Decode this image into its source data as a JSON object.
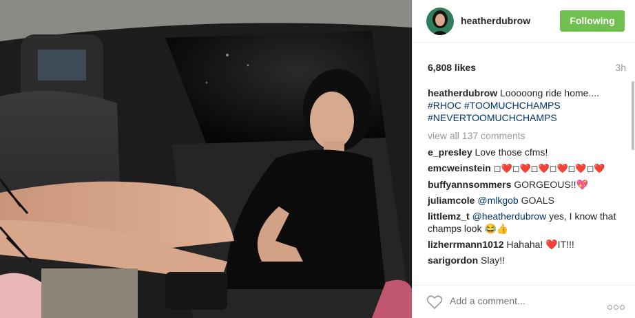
{
  "post": {
    "username": "heatherdubrow",
    "follow_label": "Following",
    "likes": "6,808 likes",
    "time": "3h",
    "caption": {
      "user": "heatherdubrow",
      "text": "Looooong ride home....",
      "tags": "#RHOC #TOOMUCHCHAMPS #NEVERTOOMUCHCHAMPS"
    },
    "view_all": "view all 137 comments",
    "comments": [
      {
        "user": "e_presley",
        "text": "Love those cfms!"
      },
      {
        "user": "emcweinstein",
        "text": "◻❤️◻❤️◻❤️◻❤️◻❤️◻❤️"
      },
      {
        "user": "buffyannsommers",
        "text": "GORGEOUS!!💖"
      },
      {
        "user": "juliamcole",
        "mention": "@mlkgob",
        "text": "GOALS"
      },
      {
        "user": "littlemz_t",
        "mention": "@heatherdubrow",
        "text": "yes, I know that champs look 😂👍"
      },
      {
        "user": "lizherrmann1012",
        "text": "Hahaha! ❤️IT!!!"
      },
      {
        "user": "sarigordon",
        "text": "Slay!!"
      }
    ],
    "add_comment_placeholder": "Add a comment...",
    "colors": {
      "follow_button": "#70c050",
      "hashtag": "#003569"
    }
  }
}
